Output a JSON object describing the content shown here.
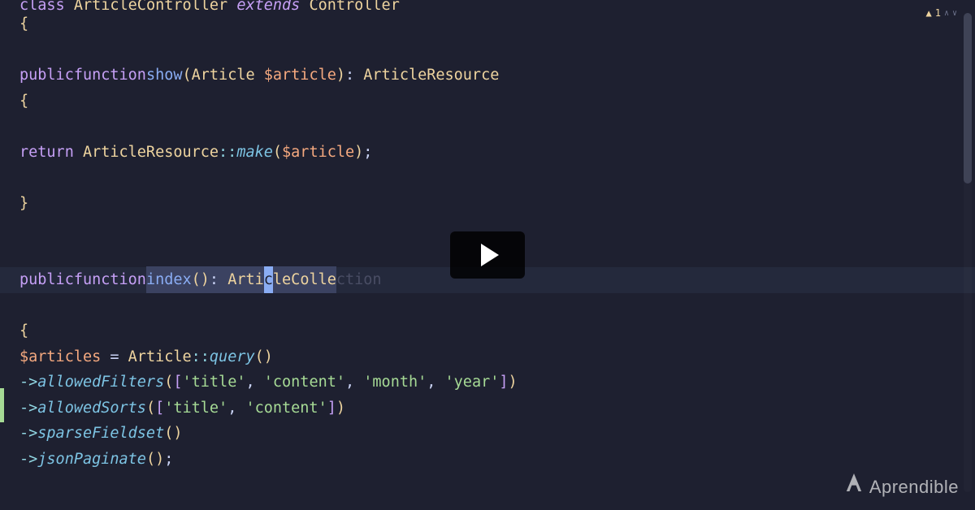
{
  "warning": {
    "icon": "▲",
    "count": "1",
    "up": "∧",
    "down": "∨"
  },
  "code": {
    "line0": {
      "class_kw": "class",
      "class_name": "ArticleController",
      "extends_kw": "extends",
      "parent": "Controller"
    },
    "brace_open": "{",
    "brace_close": "}",
    "fn_show": {
      "public": "public",
      "function": "function",
      "name": "show",
      "lp": "(",
      "param_type": "Article ",
      "param_var": "$article",
      "rp": ")",
      "colon": ": ",
      "ret_type": "ArticleResource"
    },
    "show_body": {
      "return_kw": "return ",
      "cls": "ArticleResource",
      "scope": "::",
      "make": "make",
      "lp": "(",
      "arg": "$article",
      "rp": ")",
      "semi": ";"
    },
    "fn_index": {
      "public": "public",
      "function": "function",
      "name_sel": "index",
      "lp": "(",
      "rp": ")",
      "colon": ": ",
      "ret_before": "Arti",
      "cursor_char": "c",
      "ret_after_typed": "leColle",
      "suggestion_tail": "ction"
    },
    "index_body": {
      "assign_var": "$articles",
      "eq": " = ",
      "model": "Article",
      "scope": "::",
      "query": "query",
      "lp": "(",
      "rp": ")",
      "arrow": "->",
      "m_filters": "allowedFilters",
      "filters_args": {
        "lb": "[",
        "s1": "'title'",
        "c": ", ",
        "s2": "'content'",
        "s3": "'month'",
        "s4": "'year'",
        "rb": "]"
      },
      "m_sorts": "allowedSorts",
      "sorts_args": {
        "lb": "[",
        "s1": "'title'",
        "c": ", ",
        "s2": "'content'",
        "rb": "]"
      },
      "m_sparse": "sparseFieldset",
      "m_paginate": "jsonPaginate",
      "semi": ";"
    }
  },
  "brand": "Aprendible"
}
